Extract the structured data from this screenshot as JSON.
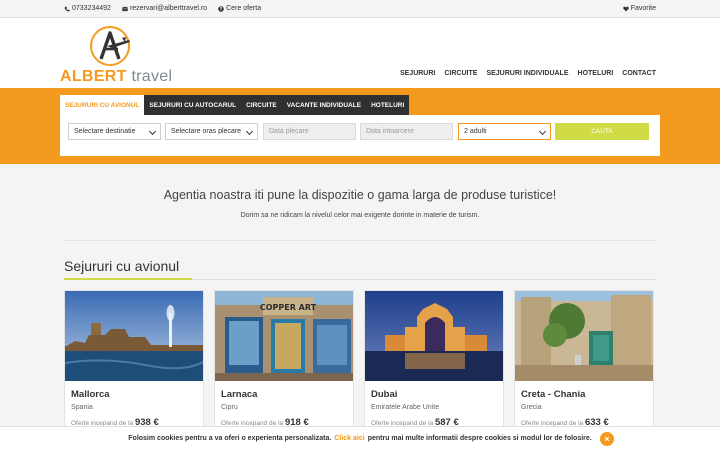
{
  "topbar": {
    "phone": "0733234492",
    "email": "rezervari@alberttravel.ro",
    "quote": "Cere oferta",
    "favorites": "Favorite"
  },
  "logo": {
    "brand_part1": "ALBERT",
    "brand_part2": "travel"
  },
  "nav": [
    "SEJURURI",
    "CIRCUITE",
    "SEJURURI INDIVIDUALE",
    "HOTELURI",
    "CONTACT"
  ],
  "tabs": [
    "SEJURURI CU AVIONUL",
    "SEJURURI CU AUTOCARUL",
    "CIRCUITE",
    "VACANTE INDIVIDUALE",
    "HOTELURI"
  ],
  "search": {
    "destination": "Selectare destinatie",
    "departure_city": "Selectare oras plecare",
    "date_start_placeholder": "Data plecare",
    "date_return_placeholder": "Data intoarcere",
    "adults": "2 adulti",
    "button": "CAUTA"
  },
  "intro": {
    "tagline": "Agentia noastra iti pune la dispozitie o gama larga de produse turistice!",
    "subtitle": "Dorim sa ne ridicam la nivelul celor mai exigente dorinte in materie de turism."
  },
  "section": {
    "title": "Sejururi cu avionul"
  },
  "cards": [
    {
      "title": "Mallorca",
      "country": "Spania",
      "offer_prefix": "Oferte incepand de la",
      "price": "938 €"
    },
    {
      "title": "Larnaca",
      "country": "Cipru",
      "offer_prefix": "Oferte incepand de la",
      "price": "918 €"
    },
    {
      "title": "Dubai",
      "country": "Emiratele Arabe Unite",
      "offer_prefix": "Oferte incepand de la",
      "price": "587 €"
    },
    {
      "title": "Creta - Chania",
      "country": "Grecia",
      "offer_prefix": "Oferte incepand de la",
      "price": "633 €"
    }
  ],
  "cookie": {
    "text_before": "Folosim cookies pentru a va oferi o experienta personalizata.",
    "link": "Click aici",
    "text_after": "pentru mai multe informatii despre cookies si modul lor de folosire.",
    "close": "×"
  },
  "colors": {
    "accent": "#f39a1f",
    "button": "#cfdc45",
    "tab_dark": "#303030"
  }
}
